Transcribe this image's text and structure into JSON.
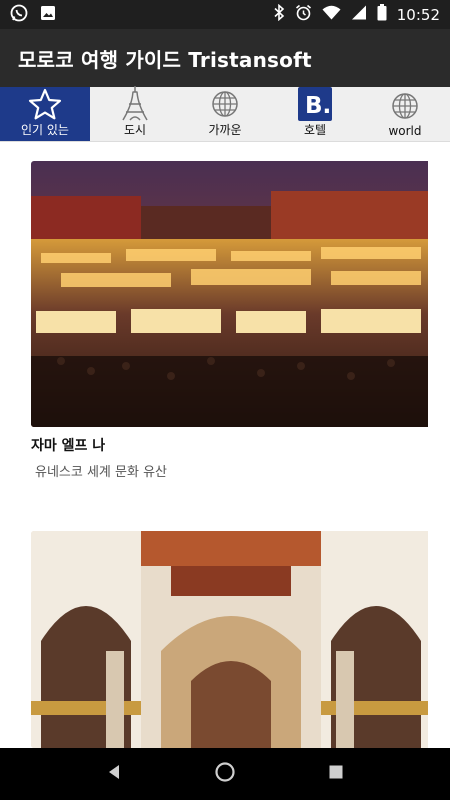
{
  "status_bar": {
    "time": "10:52",
    "left_icons": [
      "whatsapp-icon",
      "gallery-icon"
    ],
    "right_icons": [
      "bluetooth-icon",
      "alarm-icon",
      "wifi-icon",
      "signal-icon",
      "battery-icon"
    ]
  },
  "app_bar": {
    "title": "모로코 여행 가이드 Tristansoft"
  },
  "tabs": [
    {
      "label": "인기 있는",
      "icon": "star-icon",
      "active": true
    },
    {
      "label": "도시",
      "icon": "eiffel-tower-icon",
      "active": false
    },
    {
      "label": "가까운",
      "icon": "globe-grid-icon",
      "active": false
    },
    {
      "label": "호텔",
      "icon": "booking-b-icon",
      "active": false
    },
    {
      "label": "world",
      "icon": "world-icon",
      "active": false
    }
  ],
  "booking_letter": "B.",
  "cards": [
    {
      "title": "자마 엘프 나",
      "subtitle": "유네스코 세계 문화 유산",
      "image": "marrakech-night-market-photo"
    },
    {
      "title": "",
      "subtitle": "",
      "image": "mosque-interior-arches-photo"
    }
  ],
  "nav_bar": {
    "buttons": [
      "back-icon",
      "home-icon",
      "recents-icon"
    ]
  },
  "colors": {
    "status_bar": "#1f1f1f",
    "app_bar": "#2b2b2b",
    "active_tab": "#1e3a8a",
    "tab_bg": "#efefef"
  }
}
